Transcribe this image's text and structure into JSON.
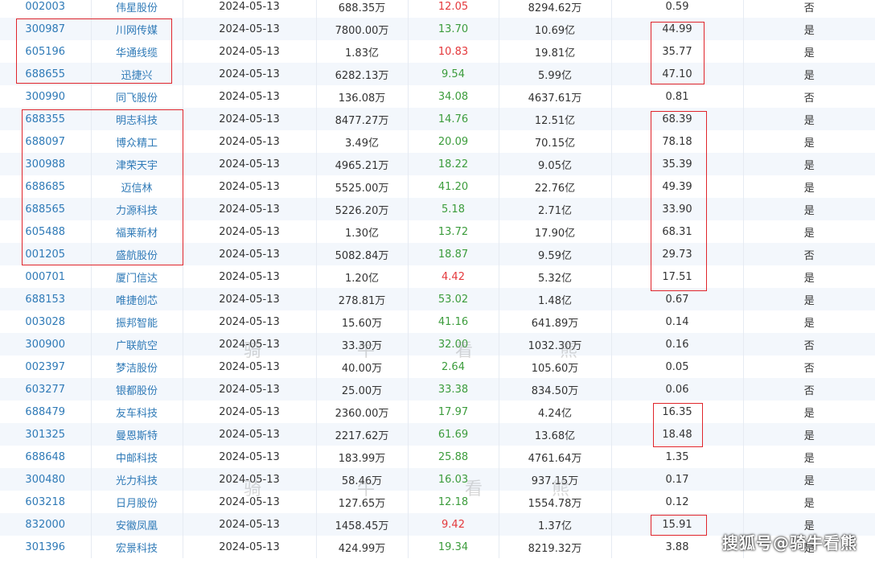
{
  "rows": [
    {
      "code": "002003",
      "name": "伟星股份",
      "date": "2024-05-13",
      "amount": "688.35万",
      "pe": "12.05",
      "pe_dir": "up",
      "mktcap": "8294.62万",
      "ratio": "0.59",
      "flag": "否"
    },
    {
      "code": "300987",
      "name": "川网传媒",
      "date": "2024-05-13",
      "amount": "7800.00万",
      "pe": "13.70",
      "pe_dir": "down",
      "mktcap": "10.69亿",
      "ratio": "44.99",
      "flag": "是"
    },
    {
      "code": "605196",
      "name": "华通线缆",
      "date": "2024-05-13",
      "amount": "1.83亿",
      "pe": "10.83",
      "pe_dir": "up",
      "mktcap": "19.81亿",
      "ratio": "35.77",
      "flag": "是"
    },
    {
      "code": "688655",
      "name": "迅捷兴",
      "date": "2024-05-13",
      "amount": "6282.13万",
      "pe": "9.54",
      "pe_dir": "down",
      "mktcap": "5.99亿",
      "ratio": "47.10",
      "flag": "是"
    },
    {
      "code": "300990",
      "name": "同飞股份",
      "date": "2024-05-13",
      "amount": "136.08万",
      "pe": "34.08",
      "pe_dir": "down",
      "mktcap": "4637.61万",
      "ratio": "0.81",
      "flag": "否"
    },
    {
      "code": "688355",
      "name": "明志科技",
      "date": "2024-05-13",
      "amount": "8477.27万",
      "pe": "14.76",
      "pe_dir": "down",
      "mktcap": "12.51亿",
      "ratio": "68.39",
      "flag": "是"
    },
    {
      "code": "688097",
      "name": "博众精工",
      "date": "2024-05-13",
      "amount": "3.49亿",
      "pe": "20.09",
      "pe_dir": "down",
      "mktcap": "70.15亿",
      "ratio": "78.18",
      "flag": "是"
    },
    {
      "code": "300988",
      "name": "津荣天宇",
      "date": "2024-05-13",
      "amount": "4965.21万",
      "pe": "18.22",
      "pe_dir": "down",
      "mktcap": "9.05亿",
      "ratio": "35.39",
      "flag": "是"
    },
    {
      "code": "688685",
      "name": "迈信林",
      "date": "2024-05-13",
      "amount": "5525.00万",
      "pe": "41.20",
      "pe_dir": "down",
      "mktcap": "22.76亿",
      "ratio": "49.39",
      "flag": "是"
    },
    {
      "code": "688565",
      "name": "力源科技",
      "date": "2024-05-13",
      "amount": "5226.20万",
      "pe": "5.18",
      "pe_dir": "down",
      "mktcap": "2.71亿",
      "ratio": "33.90",
      "flag": "是"
    },
    {
      "code": "605488",
      "name": "福莱新材",
      "date": "2024-05-13",
      "amount": "1.30亿",
      "pe": "13.72",
      "pe_dir": "down",
      "mktcap": "17.90亿",
      "ratio": "68.31",
      "flag": "是"
    },
    {
      "code": "001205",
      "name": "盛航股份",
      "date": "2024-05-13",
      "amount": "5082.84万",
      "pe": "18.87",
      "pe_dir": "down",
      "mktcap": "9.59亿",
      "ratio": "29.73",
      "flag": "否"
    },
    {
      "code": "000701",
      "name": "厦门信达",
      "date": "2024-05-13",
      "amount": "1.20亿",
      "pe": "4.42",
      "pe_dir": "up",
      "mktcap": "5.32亿",
      "ratio": "17.51",
      "flag": "是"
    },
    {
      "code": "688153",
      "name": "唯捷创芯",
      "date": "2024-05-13",
      "amount": "278.81万",
      "pe": "53.02",
      "pe_dir": "down",
      "mktcap": "1.48亿",
      "ratio": "0.67",
      "flag": "是"
    },
    {
      "code": "003028",
      "name": "振邦智能",
      "date": "2024-05-13",
      "amount": "15.60万",
      "pe": "41.16",
      "pe_dir": "down",
      "mktcap": "641.89万",
      "ratio": "0.14",
      "flag": "是"
    },
    {
      "code": "300900",
      "name": "广联航空",
      "date": "2024-05-13",
      "amount": "33.30万",
      "pe": "32.00",
      "pe_dir": "down",
      "mktcap": "1032.30万",
      "ratio": "0.16",
      "flag": "否"
    },
    {
      "code": "002397",
      "name": "梦洁股份",
      "date": "2024-05-13",
      "amount": "40.00万",
      "pe": "2.64",
      "pe_dir": "down",
      "mktcap": "105.60万",
      "ratio": "0.05",
      "flag": "否"
    },
    {
      "code": "603277",
      "name": "银都股份",
      "date": "2024-05-13",
      "amount": "25.00万",
      "pe": "33.38",
      "pe_dir": "down",
      "mktcap": "834.50万",
      "ratio": "0.06",
      "flag": "否"
    },
    {
      "code": "688479",
      "name": "友车科技",
      "date": "2024-05-13",
      "amount": "2360.00万",
      "pe": "17.97",
      "pe_dir": "down",
      "mktcap": "4.24亿",
      "ratio": "16.35",
      "flag": "是"
    },
    {
      "code": "301325",
      "name": "曼恩斯特",
      "date": "2024-05-13",
      "amount": "2217.62万",
      "pe": "61.69",
      "pe_dir": "down",
      "mktcap": "13.68亿",
      "ratio": "18.48",
      "flag": "是"
    },
    {
      "code": "688648",
      "name": "中邮科技",
      "date": "2024-05-13",
      "amount": "183.99万",
      "pe": "25.88",
      "pe_dir": "down",
      "mktcap": "4761.64万",
      "ratio": "1.35",
      "flag": "是"
    },
    {
      "code": "300480",
      "name": "光力科技",
      "date": "2024-05-13",
      "amount": "58.46万",
      "pe": "16.03",
      "pe_dir": "down",
      "mktcap": "937.15万",
      "ratio": "0.17",
      "flag": "是"
    },
    {
      "code": "603218",
      "name": "日月股份",
      "date": "2024-05-13",
      "amount": "127.65万",
      "pe": "12.18",
      "pe_dir": "down",
      "mktcap": "1554.78万",
      "ratio": "0.12",
      "flag": "是"
    },
    {
      "code": "832000",
      "name": "安徽凤凰",
      "date": "2024-05-13",
      "amount": "1458.45万",
      "pe": "9.42",
      "pe_dir": "up",
      "mktcap": "1.37亿",
      "ratio": "15.91",
      "flag": "是"
    },
    {
      "code": "301396",
      "name": "宏景科技",
      "date": "2024-05-13",
      "amount": "424.99万",
      "pe": "19.34",
      "pe_dir": "down",
      "mktcap": "8219.32万",
      "ratio": "3.88",
      "flag": "是"
    }
  ],
  "watermark": {
    "chars": [
      "骑",
      "牛",
      "看",
      "熊"
    ]
  },
  "logo": {
    "text": "搜狐号@骑牛看熊"
  },
  "colors": {
    "link": "#2f7ab7",
    "up": "#e4393c",
    "down": "#3c9c3c",
    "highlight": "#e0252b",
    "alt_row": "#f3f7fc"
  }
}
